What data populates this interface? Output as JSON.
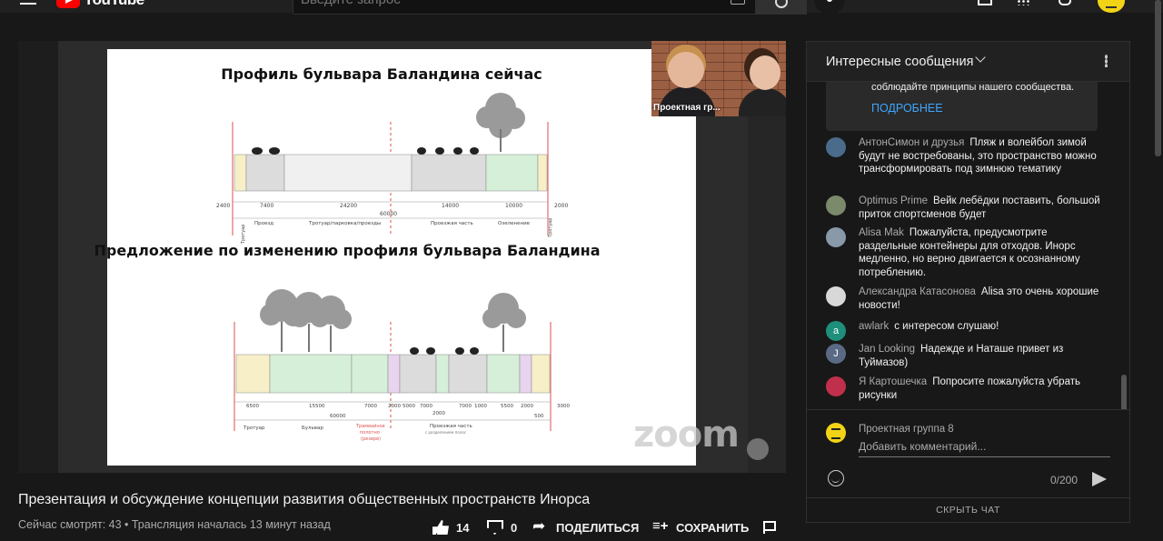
{
  "header": {
    "brand": "YouTube",
    "search_placeholder": "Введите запрос"
  },
  "video": {
    "slide": {
      "title_now": "Профиль бульвара Баландина сейчас",
      "title_proposal": "Предложение по изменению профиля бульвара Баландина",
      "top_dims": [
        "2400",
        "7400",
        "24200",
        "14000",
        "10000",
        "2000"
      ],
      "top_total": "60000",
      "top_labels": [
        "Тротуар",
        "Проезд",
        "Тротуар/парковка/проезды",
        "Проезжая часть",
        "Озеленение",
        "Тротуар"
      ],
      "bottom_dims": [
        "6500",
        "15500",
        "7000",
        "2000",
        "5000",
        "7000",
        "7000",
        "1000",
        "5500",
        "2000",
        "3000"
      ],
      "bottom_total": "60000",
      "bottom_sub": [
        "2000",
        "500"
      ],
      "bottom_labels": [
        "Тротуар",
        "Бульвар",
        "Трамвайное полотно (резерв)",
        "Проезжая часть",
        "с разделением полос"
      ]
    },
    "webcam_label": "Проектная гр...",
    "watermark": "zoom"
  },
  "info": {
    "title": "Презентация и обсуждение концепции развития общественных пространств Инорса",
    "meta": "Сейчас смотрят: 43 • Трансляция началась 13 минут назад",
    "likes": "14",
    "dislikes": "0",
    "share_label": "ПОДЕЛИТЬСЯ",
    "save_label": "СОХРАНИТЬ"
  },
  "chat": {
    "header_title": "Интересные сообщения",
    "notice_text": "соблюдайте принципы нашего сообщества.",
    "notice_link": "ПОДРОБНЕЕ",
    "messages": [
      {
        "author": "АнтонСимон и друзья",
        "text": "Пляж и волейбол зимой будут не востребованы, это пространство можно трансформировать под зимнюю тематику",
        "avatar_color": "#4a6b8a"
      },
      {
        "author": "Optimus Prime",
        "text": "Вейк лебёдки поставить, большой приток спортсменов будет",
        "avatar_color": "#7b8a6a"
      },
      {
        "author": "Alisa Mak",
        "text": "Пожалуйста, предусмотрите раздельные контейнеры для отходов. Инорс медленно, но верно двигается к осознанному потреблению.",
        "avatar_color": "#8899aa"
      },
      {
        "author": "Александра Катасонова",
        "text": "Alisa это очень хорошие новости!",
        "avatar_color": "#d8d8d8"
      },
      {
        "author": "awlark",
        "text": "с интересом слушаю!",
        "avatar_color": "#1e8f7a",
        "letter": "a"
      },
      {
        "author": "Jan Looking",
        "text": "Надежде и Наташе привет из Туймазов)",
        "avatar_color": "#5a6a85",
        "letter": "J"
      },
      {
        "author": "Я Картошечка",
        "text": "Попросите пожалуйста убрать рисунки",
        "avatar_color": "#c0304a"
      }
    ],
    "input_user": "Проектная группа 8",
    "input_placeholder": "Добавить комментарий...",
    "counter": "0/200",
    "footer": "СКРЫТЬ ЧАТ"
  }
}
